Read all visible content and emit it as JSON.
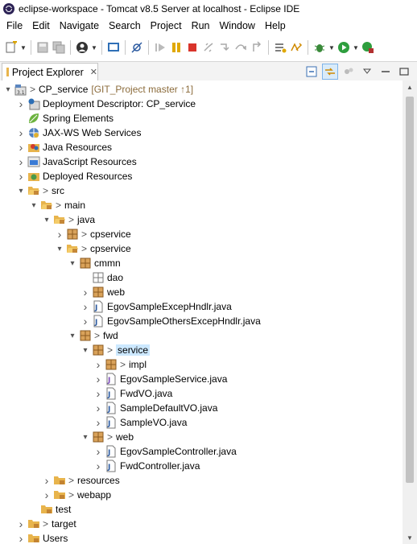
{
  "window": {
    "title": "eclipse-workspace - Tomcat v8.5 Server at localhost - Eclipse IDE"
  },
  "menu": [
    "File",
    "Edit",
    "Navigate",
    "Search",
    "Project",
    "Run",
    "Window",
    "Help"
  ],
  "view": {
    "tab_label": "Project Explorer",
    "close_glyph": "✕"
  },
  "tree": {
    "rows": [
      {
        "label": "CP_service",
        "deco": "[GIT_Project master ↑1]",
        "gt": true,
        "icon": "java-project-icon",
        "expanded": true
      },
      {
        "label": "Deployment Descriptor: CP_service",
        "icon": "deployment-descriptor-icon",
        "expanded": false
      },
      {
        "label": "Spring Elements",
        "icon": "spring-leaf-icon",
        "expanded": null
      },
      {
        "label": "JAX-WS Web Services",
        "icon": "web-services-icon",
        "expanded": false
      },
      {
        "label": "Java Resources",
        "icon": "java-resources-icon",
        "expanded": false
      },
      {
        "label": "JavaScript Resources",
        "icon": "javascript-resources-icon",
        "expanded": false
      },
      {
        "label": "Deployed Resources",
        "icon": "deployed-resources-icon",
        "expanded": false
      },
      {
        "label": "src",
        "gt": true,
        "icon": "folder-open-icon",
        "expanded": true
      },
      {
        "label": "main",
        "gt": true,
        "icon": "folder-open-icon",
        "expanded": true
      },
      {
        "label": "java",
        "gt": true,
        "icon": "folder-open-icon",
        "expanded": true
      },
      {
        "label": "cpservice",
        "gt": true,
        "icon": "package-icon",
        "expanded": false
      },
      {
        "label": "cpservice",
        "gt": true,
        "icon": "folder-open-icon",
        "expanded": true
      },
      {
        "label": "cmmn",
        "icon": "package-icon",
        "expanded": true
      },
      {
        "label": "dao",
        "icon": "package-empty-icon",
        "expanded": null
      },
      {
        "label": "web",
        "icon": "package-icon",
        "expanded": false
      },
      {
        "label": "EgovSampleExcepHndlr.java",
        "icon": "java-file-icon",
        "expanded": false
      },
      {
        "label": "EgovSampleOthersExcepHndlr.java",
        "icon": "java-file-icon",
        "expanded": false
      },
      {
        "label": "fwd",
        "gt": true,
        "icon": "package-icon",
        "expanded": true
      },
      {
        "label": "service",
        "gt": true,
        "icon": "package-icon",
        "expanded": true,
        "selected": true
      },
      {
        "label": "impl",
        "gt": true,
        "icon": "package-icon",
        "expanded": false
      },
      {
        "label": "EgovSampleService.java",
        "icon": "java-interface-file-icon",
        "expanded": false
      },
      {
        "label": "FwdVO.java",
        "icon": "java-file-icon",
        "expanded": false
      },
      {
        "label": "SampleDefaultVO.java",
        "icon": "java-file-icon",
        "expanded": false
      },
      {
        "label": "SampleVO.java",
        "icon": "java-file-icon",
        "expanded": false
      },
      {
        "label": "web",
        "gt": true,
        "icon": "package-icon",
        "expanded": true
      },
      {
        "label": "EgovSampleController.java",
        "icon": "java-file-icon",
        "expanded": false
      },
      {
        "label": "FwdController.java",
        "icon": "java-file-icon",
        "expanded": false
      },
      {
        "label": "resources",
        "gt": true,
        "icon": "folder-closed-icon",
        "expanded": false
      },
      {
        "label": "webapp",
        "gt": true,
        "icon": "folder-closed-icon",
        "expanded": false
      },
      {
        "label": "test",
        "icon": "folder-closed-icon",
        "expanded": null
      },
      {
        "label": "target",
        "gt": true,
        "icon": "folder-closed-icon",
        "expanded": false
      },
      {
        "label": "Users",
        "icon": "folder-closed-icon",
        "expanded": false
      }
    ]
  },
  "colors": {
    "selection": "#cce8ff",
    "decoration": "#8c6c3c",
    "folder": "#e8b44c",
    "package": "#b9772c"
  }
}
